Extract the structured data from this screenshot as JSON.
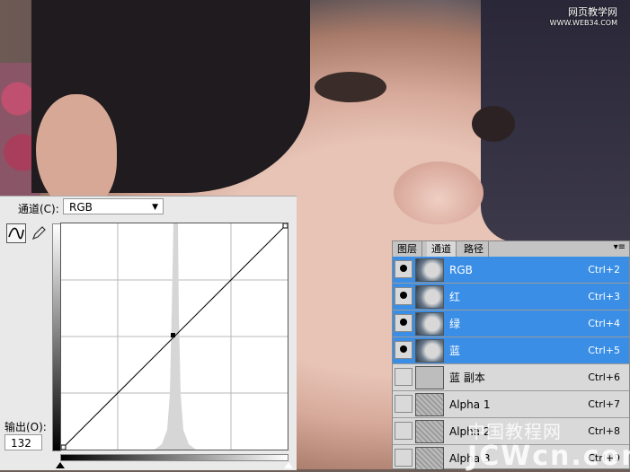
{
  "watermark": {
    "top_line1": "网页教学网",
    "top_line2": "WWW.WEB34.COM",
    "bottom_cn": "中国教程网",
    "bottom_en": "JCWcn.com"
  },
  "curves_panel": {
    "channel_label": "通道(C):",
    "channel_value": "RGB",
    "output_label": "输出(O):",
    "output_value": "132",
    "tools": [
      "curve-tool-icon",
      "pencil-icon"
    ]
  },
  "channels_panel": {
    "tabs": [
      {
        "label": "图层",
        "active": false
      },
      {
        "label": "通道",
        "active": true
      },
      {
        "label": "路径",
        "active": false
      }
    ],
    "rows": [
      {
        "name": "RGB",
        "shortcut": "Ctrl+2",
        "selected": true,
        "visible": true,
        "thumb": "face"
      },
      {
        "name": "红",
        "shortcut": "Ctrl+3",
        "selected": true,
        "visible": true,
        "thumb": "face"
      },
      {
        "name": "绿",
        "shortcut": "Ctrl+4",
        "selected": true,
        "visible": true,
        "thumb": "face"
      },
      {
        "name": "蓝",
        "shortcut": "Ctrl+5",
        "selected": true,
        "visible": true,
        "thumb": "face"
      },
      {
        "name": "蓝 副本",
        "shortcut": "Ctrl+6",
        "selected": false,
        "visible": false,
        "thumb": "plain"
      },
      {
        "name": "Alpha 1",
        "shortcut": "Ctrl+7",
        "selected": false,
        "visible": false,
        "thumb": "noise"
      },
      {
        "name": "Alpha 2",
        "shortcut": "Ctrl+8",
        "selected": false,
        "visible": false,
        "thumb": "noise"
      },
      {
        "name": "Alpha 3",
        "shortcut": "Ctrl+9",
        "selected": false,
        "visible": false,
        "thumb": "noise"
      }
    ]
  },
  "colors": {
    "selection": "#3a8ee6",
    "panel_bg": "#d9d9d9"
  }
}
